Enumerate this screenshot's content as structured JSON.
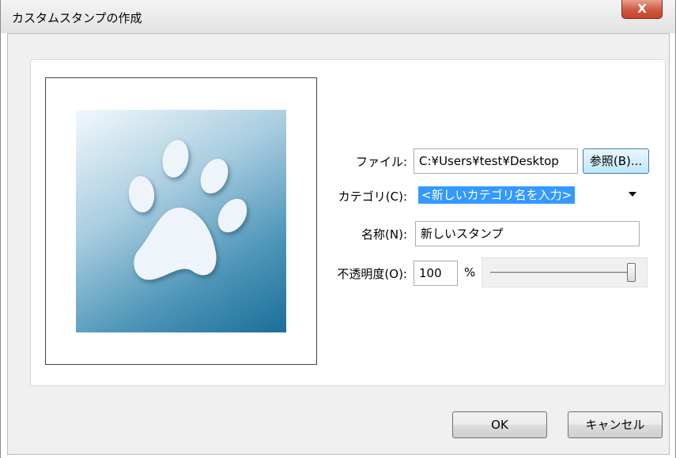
{
  "window": {
    "title": "カスタムスタンプの作成",
    "close_glyph": "X"
  },
  "form": {
    "file": {
      "label": "ファイル:",
      "value": "C:¥Users¥test¥Desktop",
      "browse_label": "参照(B)..."
    },
    "category": {
      "label": "カテゴリ(C):",
      "value": "<新しいカテゴリ名を入力>"
    },
    "name": {
      "label": "名称(N):",
      "value": "新しいスタンプ"
    },
    "opacity": {
      "label": "不透明度(O):",
      "value": "100",
      "unit": "%",
      "slider_percent": 100
    }
  },
  "preview": {
    "image_icon": "paw-print-icon"
  },
  "buttons": {
    "ok": "OK",
    "cancel": "キャンセル"
  },
  "colors": {
    "selection": "#3399ff",
    "close_button": "#c3452c",
    "stamp_blue": "#1a6f99"
  }
}
